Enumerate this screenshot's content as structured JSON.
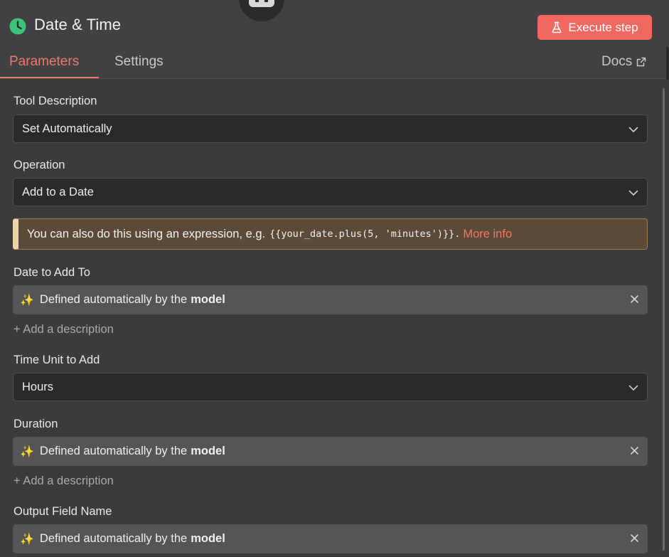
{
  "header": {
    "title": "Date & Time",
    "execute_label": "Execute step",
    "tabs": [
      {
        "label": "Parameters",
        "active": true
      },
      {
        "label": "Settings",
        "active": false
      }
    ],
    "docs_label": "Docs"
  },
  "colors": {
    "accent": "#f0685f",
    "node_icon": "#3cc47c",
    "panel_bg": "#3b3b3d",
    "notice_bg": "#5a4a37"
  },
  "fields": {
    "tool_description": {
      "label": "Tool Description",
      "value": "Set Automatically"
    },
    "operation": {
      "label": "Operation",
      "value": "Add to a Date"
    },
    "notice": {
      "text": "You can also do this using an expression, e.g.",
      "code": "{{your_date.plus(5, 'minutes')}}.",
      "link": "More info"
    },
    "date_to_add_to": {
      "label": "Date to Add To",
      "prefix": "Defined automatically by the",
      "bold": "model",
      "add_description": "+ Add a description"
    },
    "time_unit": {
      "label": "Time Unit to Add",
      "value": "Hours"
    },
    "duration": {
      "label": "Duration",
      "prefix": "Defined automatically by the",
      "bold": "model",
      "add_description": "+ Add a description"
    },
    "output_field_name": {
      "label": "Output Field Name",
      "prefix": "Defined automatically by the",
      "bold": "model"
    }
  },
  "icons": {
    "node": "clock-icon",
    "execute": "flask-icon",
    "docs": "external-link-icon",
    "dropdown": "chevron-down-icon",
    "ai": "sparkles-icon",
    "clear": "close-icon",
    "agent": "robot-icon"
  }
}
